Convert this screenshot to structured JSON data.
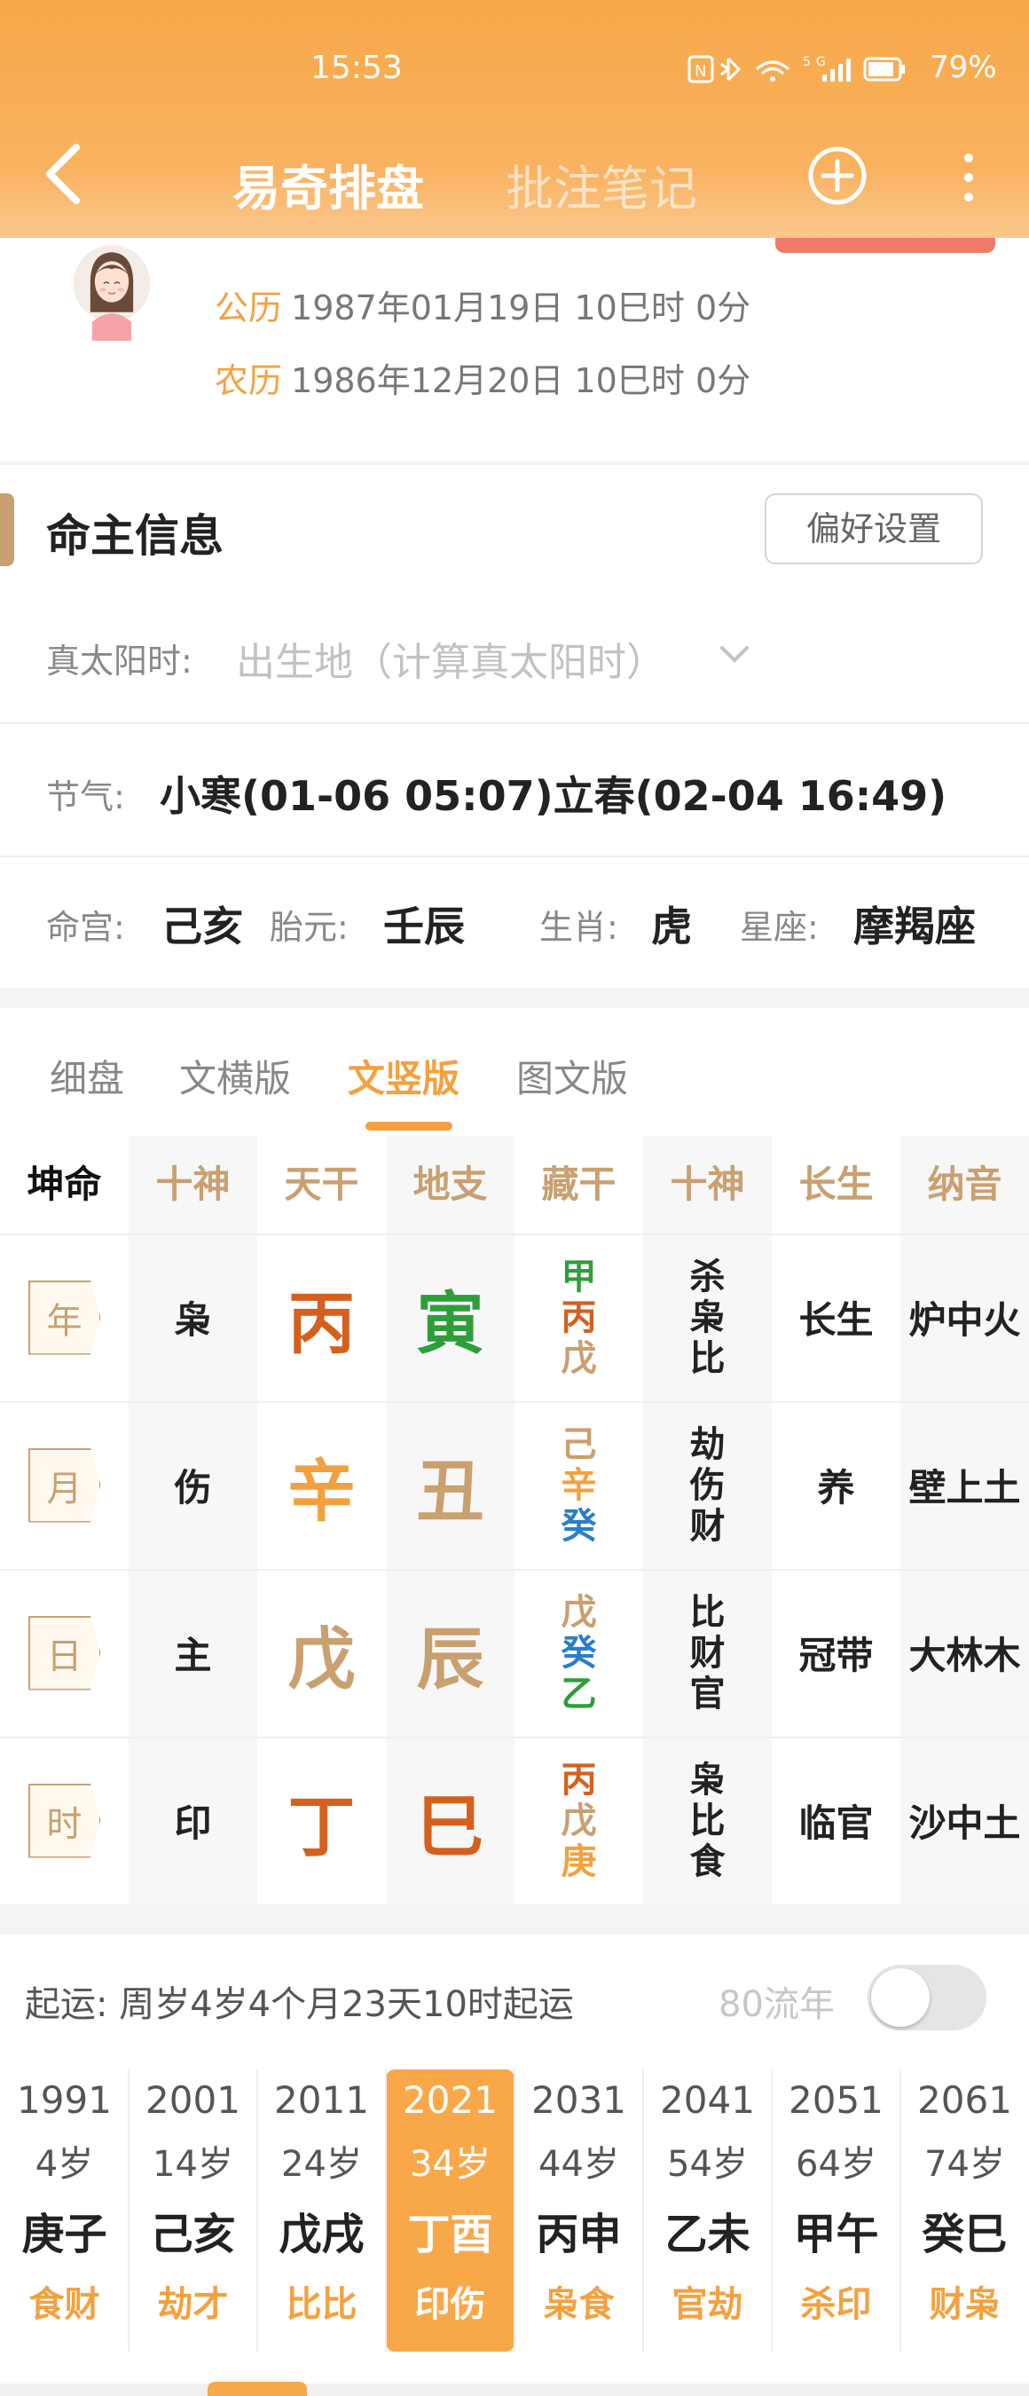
{
  "status_bar": {
    "time": "15:53",
    "icons": "NFC 🔵 WiFi 5G",
    "battery": "79%"
  },
  "header": {
    "tab_main": "易奇排盘",
    "tab_note": "批注笔记"
  },
  "profile": {
    "sun_label": "公历",
    "sun_value": "1987年01月19日 10巳时 0分",
    "lunar_label": "农历",
    "lunar_value": "1986年12月20日 10巳时 0分"
  },
  "info": {
    "title": "命主信息",
    "pref_button": "偏好设置",
    "solar_label": "真太阳时:",
    "solar_placeholder": "出生地（计算真太阳时）",
    "jieqi_label": "节气:",
    "jieqi_value": "小寒(01-06 05:07)立春(02-04 16:49)",
    "minggong_label": "命宫:",
    "minggong_value": "己亥",
    "taiyuan_label": "胎元:",
    "taiyuan_value": "壬辰",
    "shengxiao_label": "生肖:",
    "shengxiao_value": "虎",
    "xingzuo_label": "星座:",
    "xingzuo_value": "摩羯座"
  },
  "chart": {
    "modes": [
      "细盘",
      "文横版",
      "文竖版",
      "图文版"
    ],
    "active_mode": "文竖版",
    "gender": "坤命",
    "headers": [
      "十神",
      "天干",
      "地支",
      "藏干",
      "十神",
      "长生",
      "纳音"
    ],
    "pillars": [
      {
        "tag": "年",
        "shishen": "枭",
        "tg": "丙",
        "dz": "寅",
        "cg": [
          {
            "c": "甲",
            "color": "#2e9e3a"
          },
          {
            "c": "丙",
            "color": "#d5601e"
          },
          {
            "c": "戊",
            "color": "#c9a070"
          }
        ],
        "cgss": [
          "杀",
          "枭",
          "比"
        ],
        "cs": "长生",
        "ny": "炉中火"
      },
      {
        "tag": "月",
        "shishen": "伤",
        "tg": "辛",
        "dz": "丑",
        "cg": [
          {
            "c": "己",
            "color": "#c9a070"
          },
          {
            "c": "辛",
            "color": "#f3a13f"
          },
          {
            "c": "癸",
            "color": "#2a7ec9"
          }
        ],
        "cgss": [
          "劫",
          "伤",
          "财"
        ],
        "cs": "养",
        "ny": "壁上土"
      },
      {
        "tag": "日",
        "shishen": "主",
        "tg": "戊",
        "dz": "辰",
        "cg": [
          {
            "c": "戊",
            "color": "#c9a070"
          },
          {
            "c": "癸",
            "color": "#2a7ec9"
          },
          {
            "c": "乙",
            "color": "#2e9e3a"
          }
        ],
        "cgss": [
          "比",
          "财",
          "官"
        ],
        "cs": "冠带",
        "ny": "大林木"
      },
      {
        "tag": "时",
        "shishen": "印",
        "tg": "丁",
        "dz": "巳",
        "cg": [
          {
            "c": "丙",
            "color": "#d5601e"
          },
          {
            "c": "戊",
            "color": "#c9a070"
          },
          {
            "c": "庚",
            "color": "#f3a13f"
          }
        ],
        "cgss": [
          "枭",
          "比",
          "食"
        ],
        "cs": "临官",
        "ny": "沙中土"
      }
    ],
    "colors": {
      "fire": "#d5601e",
      "wood": "#2e9e3a",
      "metal": "#f3a13f",
      "earth": "#c9a070",
      "water": "#2a7ec9"
    }
  },
  "luck": {
    "qiyun_label": "起运:",
    "qiyun_value": "周岁4岁4个月23天10时起运",
    "liunian_label": "80流年",
    "dayun": [
      {
        "year": "1991",
        "age": "4岁",
        "gz": "庚子",
        "ss": "食财"
      },
      {
        "year": "2001",
        "age": "14岁",
        "gz": "己亥",
        "ss": "劫才"
      },
      {
        "year": "2011",
        "age": "24岁",
        "gz": "戊戌",
        "ss": "比比"
      },
      {
        "year": "2021",
        "age": "34岁",
        "gz": "丁酉",
        "ss": "印伤"
      },
      {
        "year": "2031",
        "age": "44岁",
        "gz": "丙申",
        "ss": "枭食"
      },
      {
        "year": "2041",
        "age": "54岁",
        "gz": "乙未",
        "ss": "官劫"
      },
      {
        "year": "2051",
        "age": "64岁",
        "gz": "甲午",
        "ss": "杀印"
      },
      {
        "year": "2061",
        "age": "74岁",
        "gz": "癸巳",
        "ss": "财枭"
      }
    ],
    "active_index": 3
  }
}
